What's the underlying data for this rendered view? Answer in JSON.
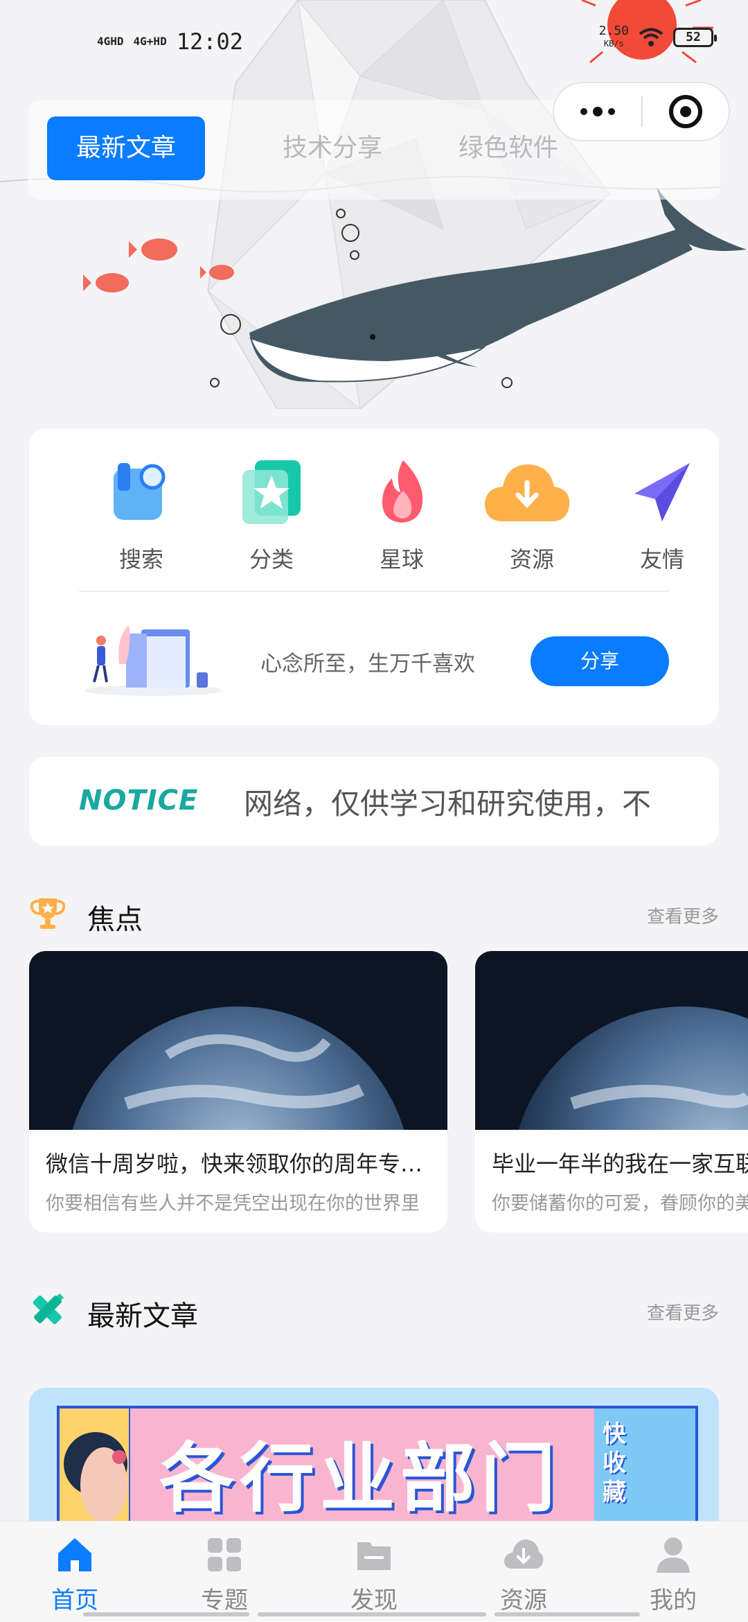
{
  "status_bar": {
    "network1": "4GHD",
    "network2": "4G+HD",
    "time": "12:02",
    "speed": "2.50",
    "speed_unit": "KB/s",
    "battery": "52"
  },
  "top_tabs": [
    {
      "label": "最新文章",
      "active": true
    },
    {
      "label": "技术分享",
      "active": false
    },
    {
      "label": "绿色软件",
      "active": false
    }
  ],
  "nav": {
    "items": [
      {
        "label": "搜索",
        "icon": "search-icon"
      },
      {
        "label": "分类",
        "icon": "category-icon"
      },
      {
        "label": "星球",
        "icon": "flame-icon"
      },
      {
        "label": "资源",
        "icon": "cloud-download-icon"
      },
      {
        "label": "友情",
        "icon": "paper-plane-icon"
      }
    ],
    "slogan": "心念所至，生万千喜欢",
    "share_label": "分享"
  },
  "notice": {
    "logo": "NOTICE",
    "text": "网络，仅供学习和研究使用，不"
  },
  "focus": {
    "title": "焦点",
    "more": "查看更多",
    "cards": [
      {
        "title": "微信十周岁啦，快来领取你的周年专属报告",
        "subtitle": "你要相信有些人并不是凭空出现在你的世界里"
      },
      {
        "title": "毕业一年半的我在一家互联网公司",
        "subtitle": "你要储蓄你的可爱，眷顾你的美好"
      }
    ]
  },
  "latest": {
    "title": "最新文章",
    "more": "查看更多",
    "banner_text": "各行业部门",
    "banner_side": "快收藏"
  },
  "tabbar": [
    {
      "label": "首页",
      "icon": "home-icon",
      "active": true
    },
    {
      "label": "专题",
      "icon": "grid-icon",
      "active": false
    },
    {
      "label": "发现",
      "icon": "folder-icon",
      "active": false
    },
    {
      "label": "资源",
      "icon": "cloud-download-icon",
      "active": false
    },
    {
      "label": "我的",
      "icon": "user-icon",
      "active": false
    }
  ],
  "colors": {
    "accent": "#0a7cff",
    "whale": "#455965",
    "fish": "#f26b5b",
    "notice_teal": "#1aa9a0"
  }
}
